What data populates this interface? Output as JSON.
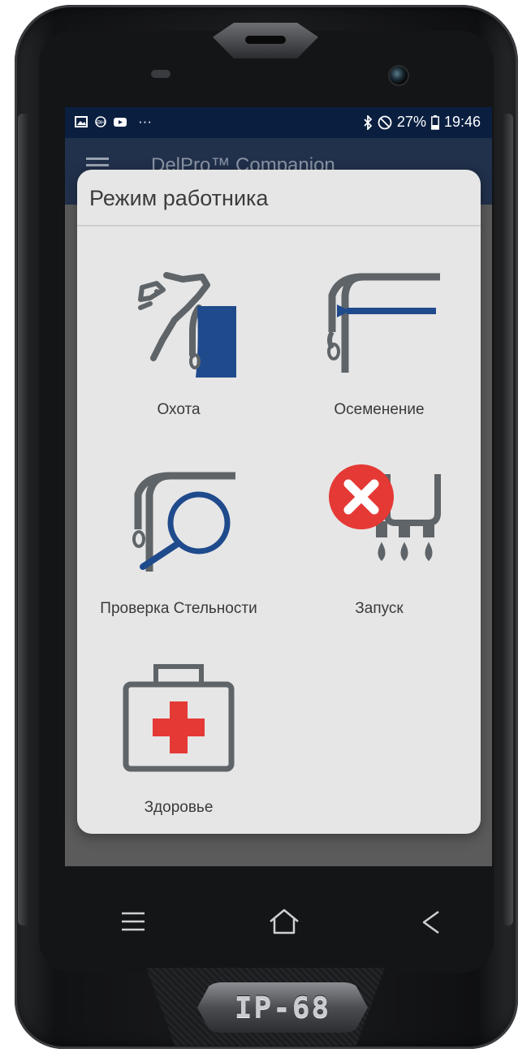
{
  "status_bar": {
    "time": "19:46",
    "battery": "27%",
    "icons_left": [
      "image-icon",
      "eh-icon",
      "youtube-icon",
      "more-dots-icon"
    ],
    "icons_right": [
      "bluetooth-icon",
      "dnd-icon",
      "battery-icon"
    ],
    "dots": "···"
  },
  "app_bar": {
    "title": "DelPro™ Companion",
    "menu_icon": "hamburger-menu-icon"
  },
  "dialog": {
    "title": "Режим работника",
    "items": [
      {
        "label": "Охота",
        "icon": "cow-heat-icon"
      },
      {
        "label": "Осеменение",
        "icon": "insemination-icon"
      },
      {
        "label": "Проверка Стельности",
        "icon": "pregnancy-check-icon"
      },
      {
        "label": "Запуск",
        "icon": "dry-off-icon"
      },
      {
        "label": "Здоровье",
        "icon": "first-aid-kit-icon"
      }
    ]
  },
  "device": {
    "badge": "IP-68",
    "nav_keys": [
      "menu-key-icon",
      "home-key-icon",
      "back-key-icon"
    ]
  },
  "colors": {
    "status_bar": "#0a1f40",
    "dialog_bg": "#e6e6e6",
    "icon_gray": "#5f6468",
    "icon_blue": "#1f4a8c",
    "alert_red": "#e53935"
  }
}
